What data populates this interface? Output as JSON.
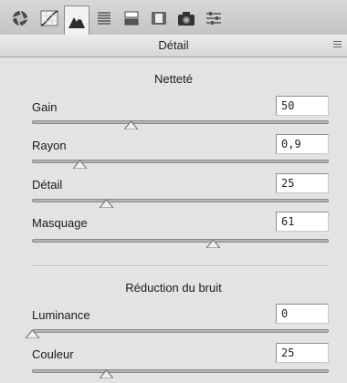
{
  "panel": {
    "title": "Détail"
  },
  "tabs": [
    {
      "icon": "aperture-icon",
      "active": false
    },
    {
      "icon": "tone-curve-icon",
      "active": false
    },
    {
      "icon": "detail-mountains-icon",
      "active": true
    },
    {
      "icon": "hsl-lines-icon",
      "active": false
    },
    {
      "icon": "split-toning-icon",
      "active": false
    },
    {
      "icon": "lens-corrections-icon",
      "active": false
    },
    {
      "icon": "camera-icon",
      "active": false
    },
    {
      "icon": "presets-sliders-icon",
      "active": false
    }
  ],
  "sharpening": {
    "title": "Netteté",
    "sliders": [
      {
        "label": "Gain",
        "value": "50",
        "level": 0.333
      },
      {
        "label": "Rayon",
        "value": "0,9",
        "level": 0.16
      },
      {
        "label": "Détail",
        "value": "25",
        "level": 0.25
      },
      {
        "label": "Masquage",
        "value": "61",
        "level": 0.61
      }
    ]
  },
  "noise_reduction": {
    "title": "Réduction du bruit",
    "sliders": [
      {
        "label": "Luminance",
        "value": "0",
        "level": 0.0
      },
      {
        "label": "Couleur",
        "value": "25",
        "level": 0.25
      }
    ]
  }
}
